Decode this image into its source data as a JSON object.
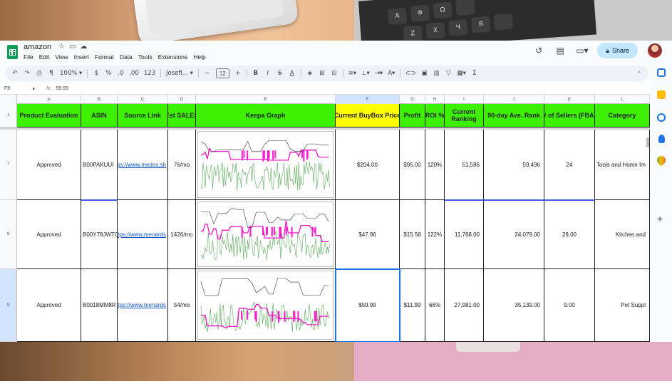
{
  "doc": {
    "title": "amazon"
  },
  "menu": [
    "File",
    "Edit",
    "View",
    "Insert",
    "Format",
    "Data",
    "Tools",
    "Extensions",
    "Help"
  ],
  "share_label": "Share",
  "toolbar": {
    "zoom": "100%",
    "currency": "$",
    "percent": "%",
    "dec_dec": ".0",
    "inc_dec": ".00",
    "number_fmt": "123",
    "font": "Josefi...",
    "font_size": "12"
  },
  "formula_bar": {
    "cell_ref": "F9",
    "fx": "fx",
    "value": "59.99"
  },
  "columns": [
    "A",
    "B",
    "C",
    "D",
    "E",
    "F",
    "G",
    "H",
    "I",
    "J",
    "K",
    "L"
  ],
  "headers": {
    "row_num": "1",
    "cells": [
      "Product Evaluation",
      "ASIN",
      "Source Link",
      "Est SALES",
      "Keepa Graph",
      "Current BuyBox Price",
      "Profit",
      "ROI %",
      "Current Ranking",
      "90-day Ave. Rank",
      "# of Sellers (FBA)",
      "Category"
    ]
  },
  "rows": [
    {
      "num": "7",
      "eval": "Approved",
      "asin": "B00PAKUUI",
      "link": "https://www.medos.sh",
      "sales": "76/mo",
      "price": "$204.00",
      "profit": "$95.00",
      "roi": "120%",
      "rank": "51,586",
      "avg_rank": "59,496",
      "sellers": "24",
      "category": "Tools and Home Im"
    },
    {
      "num": "8",
      "eval": "Approved",
      "asin": "B00Y78JWTQ",
      "link": "https://www.menards.",
      "sales": "1426/mo",
      "price": "$47.96",
      "profit": "$15.58",
      "roi": "122%",
      "rank": "11,768.00",
      "avg_rank": "24,079.00",
      "sellers": "29.00",
      "category": "Kitchen and"
    },
    {
      "num": "9",
      "eval": "Approved",
      "asin": "B0018MM8R",
      "link": "https://www.menards.",
      "sales": "54/mo",
      "price": "$59.99",
      "profit": "$11.99",
      "roi": "66%",
      "rank": "27,981.00",
      "avg_rank": "35,139.00",
      "sellers": "9.00",
      "category": "Pet Suppl"
    }
  ],
  "keyboard_keys": [
    "A",
    "Φ",
    "Ω",
    "Z",
    "X",
    "Ч",
    "Я"
  ],
  "colors": {
    "header_green": "#3cf000",
    "header_yellow": "#ffff00",
    "selection": "#1a73e8",
    "sheets_green": "#0f9d58"
  }
}
